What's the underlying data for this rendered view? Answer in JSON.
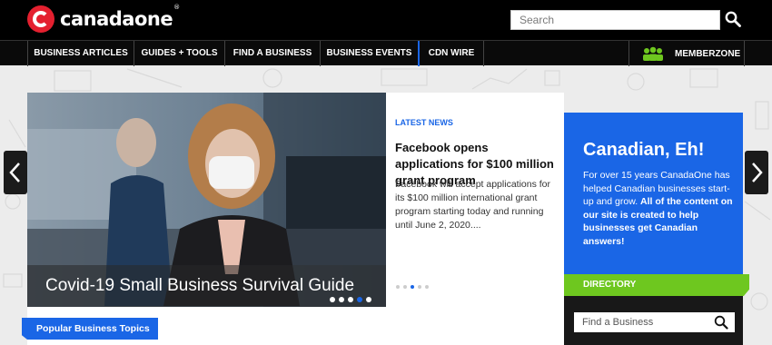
{
  "brand": {
    "name": "canadaone",
    "mark": "®"
  },
  "search": {
    "placeholder": "Search"
  },
  "nav": {
    "items": [
      "BUSINESS ARTICLES",
      "GUIDES + TOOLS",
      "FIND A BUSINESS",
      "BUSINESS EVENTS",
      "CDN WIRE"
    ],
    "member_label": "MEMBERZONE"
  },
  "hero": {
    "caption": "Covid-19 Small Business Survival Guide",
    "dot_count": 5,
    "active_dot": 4
  },
  "news": {
    "kicker": "LATEST NEWS",
    "title": "Facebook opens applications for $100 million grant program",
    "body": "Facebook will accept applications for its $100 million international grant program starting today and running until June 2, 2020....",
    "dot_count": 5,
    "active_dot": 3
  },
  "promo": {
    "title": "Canadian, Eh!",
    "body_plain": "For over 15 years CanadaOne has helped Canadian businesses start-up and grow. ",
    "body_bold": "All of the content on our site is created to help businesses get Canadian answers!"
  },
  "directory": {
    "heading": "DIRECTORY",
    "placeholder": "Find a Business"
  },
  "topics": {
    "heading": "Popular Business Topics"
  },
  "colors": {
    "accent_blue": "#1a66e6",
    "green": "#6ec71f",
    "brand_red": "#e4202f"
  }
}
